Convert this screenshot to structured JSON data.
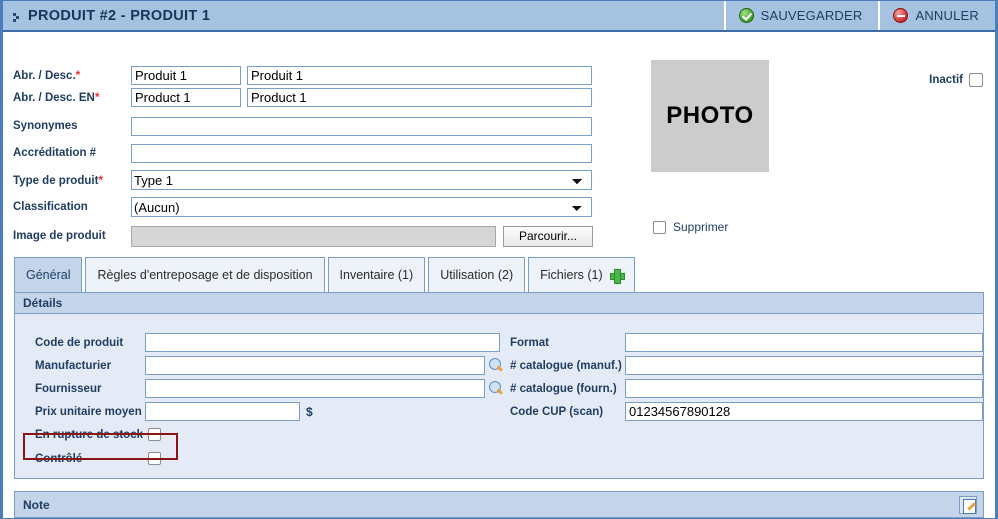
{
  "window": {
    "title": "PRODUIT #2 - PRODUIT 1",
    "expand_icon": "expand-chevron-icon"
  },
  "toolbar": {
    "save_label": "SAUVEGARDER",
    "save_icon": "green-check-circle-icon",
    "cancel_label": "ANNULER",
    "cancel_icon": "red-cancel-circle-icon"
  },
  "header_form": {
    "inactif_label": "Inactif",
    "inactif_checked": false,
    "photo_placeholder": "PHOTO",
    "supprimer_label": "Supprimer",
    "supprimer_checked": false,
    "rows": [
      {
        "label": "Abr. / Desc.",
        "required": true,
        "abbr": "Produit 1",
        "desc": "Produit 1"
      },
      {
        "label": "Abr. / Desc. EN",
        "required": true,
        "abbr": "Product 1",
        "desc": "Product 1"
      },
      {
        "label": "Synonymes",
        "required": false,
        "value": ""
      },
      {
        "label": "Accréditation #",
        "required": false,
        "value": ""
      },
      {
        "label": "Type de produit",
        "required": true,
        "value": "Type 1"
      },
      {
        "label": "Classification",
        "required": false,
        "value": "(Aucun)"
      },
      {
        "label": "Image de produit",
        "required": false,
        "value": ""
      }
    ],
    "type_options": [
      "Type 1"
    ],
    "classification_options": [
      "(Aucun)"
    ],
    "browse_label": "Parcourir..."
  },
  "tabs": [
    {
      "label": "Général",
      "active": true
    },
    {
      "label": "Règles d'entreposage et de disposition",
      "active": false
    },
    {
      "label": "Inventaire (1)",
      "active": false
    },
    {
      "label": "Utilisation (2)",
      "active": false
    },
    {
      "label": "Fichiers (1)",
      "active": false,
      "icon": "green-plus-icon"
    }
  ],
  "details": {
    "header": "Détails",
    "highlight_color": "#8b1414",
    "left": [
      {
        "label": "Code de produit",
        "value": ""
      },
      {
        "label": "Manufacturier",
        "value": "",
        "lookup_icon": "magnifier-icon"
      },
      {
        "label": "Fournisseur",
        "value": "",
        "lookup_icon": "magnifier-icon"
      },
      {
        "label": "Prix unitaire moyen",
        "value": "",
        "suffix": "$"
      },
      {
        "label": "En rupture de stock",
        "checked": false
      },
      {
        "label": "Contrôlé",
        "checked": false,
        "highlighted": true
      }
    ],
    "right": [
      {
        "label": "Format",
        "value": ""
      },
      {
        "label": "# catalogue (manuf.)",
        "value": ""
      },
      {
        "label": "# catalogue (fourn.)",
        "value": ""
      },
      {
        "label": "Code CUP (scan)",
        "value": "01234567890128"
      }
    ]
  },
  "note": {
    "label": "Note",
    "icon": "note-edit-icon"
  }
}
